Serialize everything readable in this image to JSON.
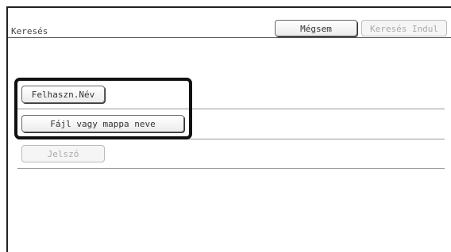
{
  "header": {
    "title": "Keresés",
    "cancel_label": "Mégsem",
    "search_start_label": "Keresés Indul"
  },
  "fields": {
    "username_label": "Felhaszn.Név",
    "file_folder_label": "Fájl vagy mappa neve",
    "password_label": "Jelszó"
  },
  "colors": {
    "border": "#222222",
    "highlight": "#111111",
    "disabled_text": "#aaaaaa"
  }
}
